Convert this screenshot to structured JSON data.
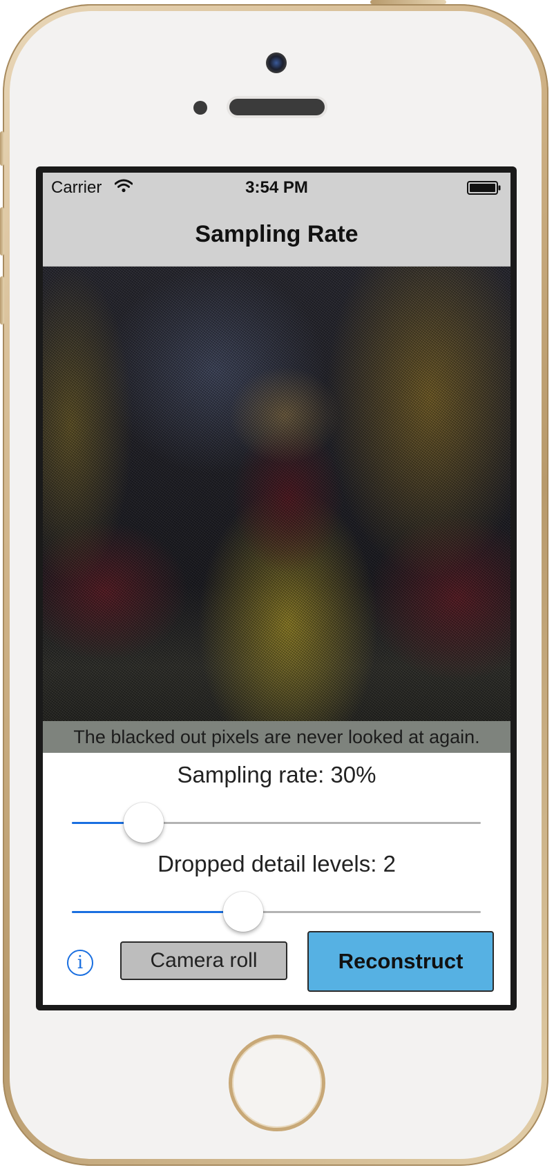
{
  "status_bar": {
    "carrier": "Carrier",
    "time": "3:54 PM",
    "wifi_icon": "wifi-icon",
    "battery_icon": "battery-full-icon"
  },
  "nav": {
    "title": "Sampling Rate"
  },
  "photo": {
    "caption": "The blacked out pixels are never looked at again."
  },
  "controls": {
    "sampling_label": "Sampling rate: 30%",
    "sampling_value": 0.14,
    "detail_label": "Dropped detail levels: 2",
    "detail_value": 0.41,
    "info_icon": "info-icon",
    "info_glyph": "i",
    "camera_roll_label": "Camera roll",
    "reconstruct_label": "Reconstruct"
  },
  "colors": {
    "accent": "#1a6fe0",
    "nav_background": "#d1d1d1",
    "reconstruct_button": "#56b1e3",
    "camera_roll_button": "#bdbdbd",
    "device_gold": "#cfb286"
  }
}
